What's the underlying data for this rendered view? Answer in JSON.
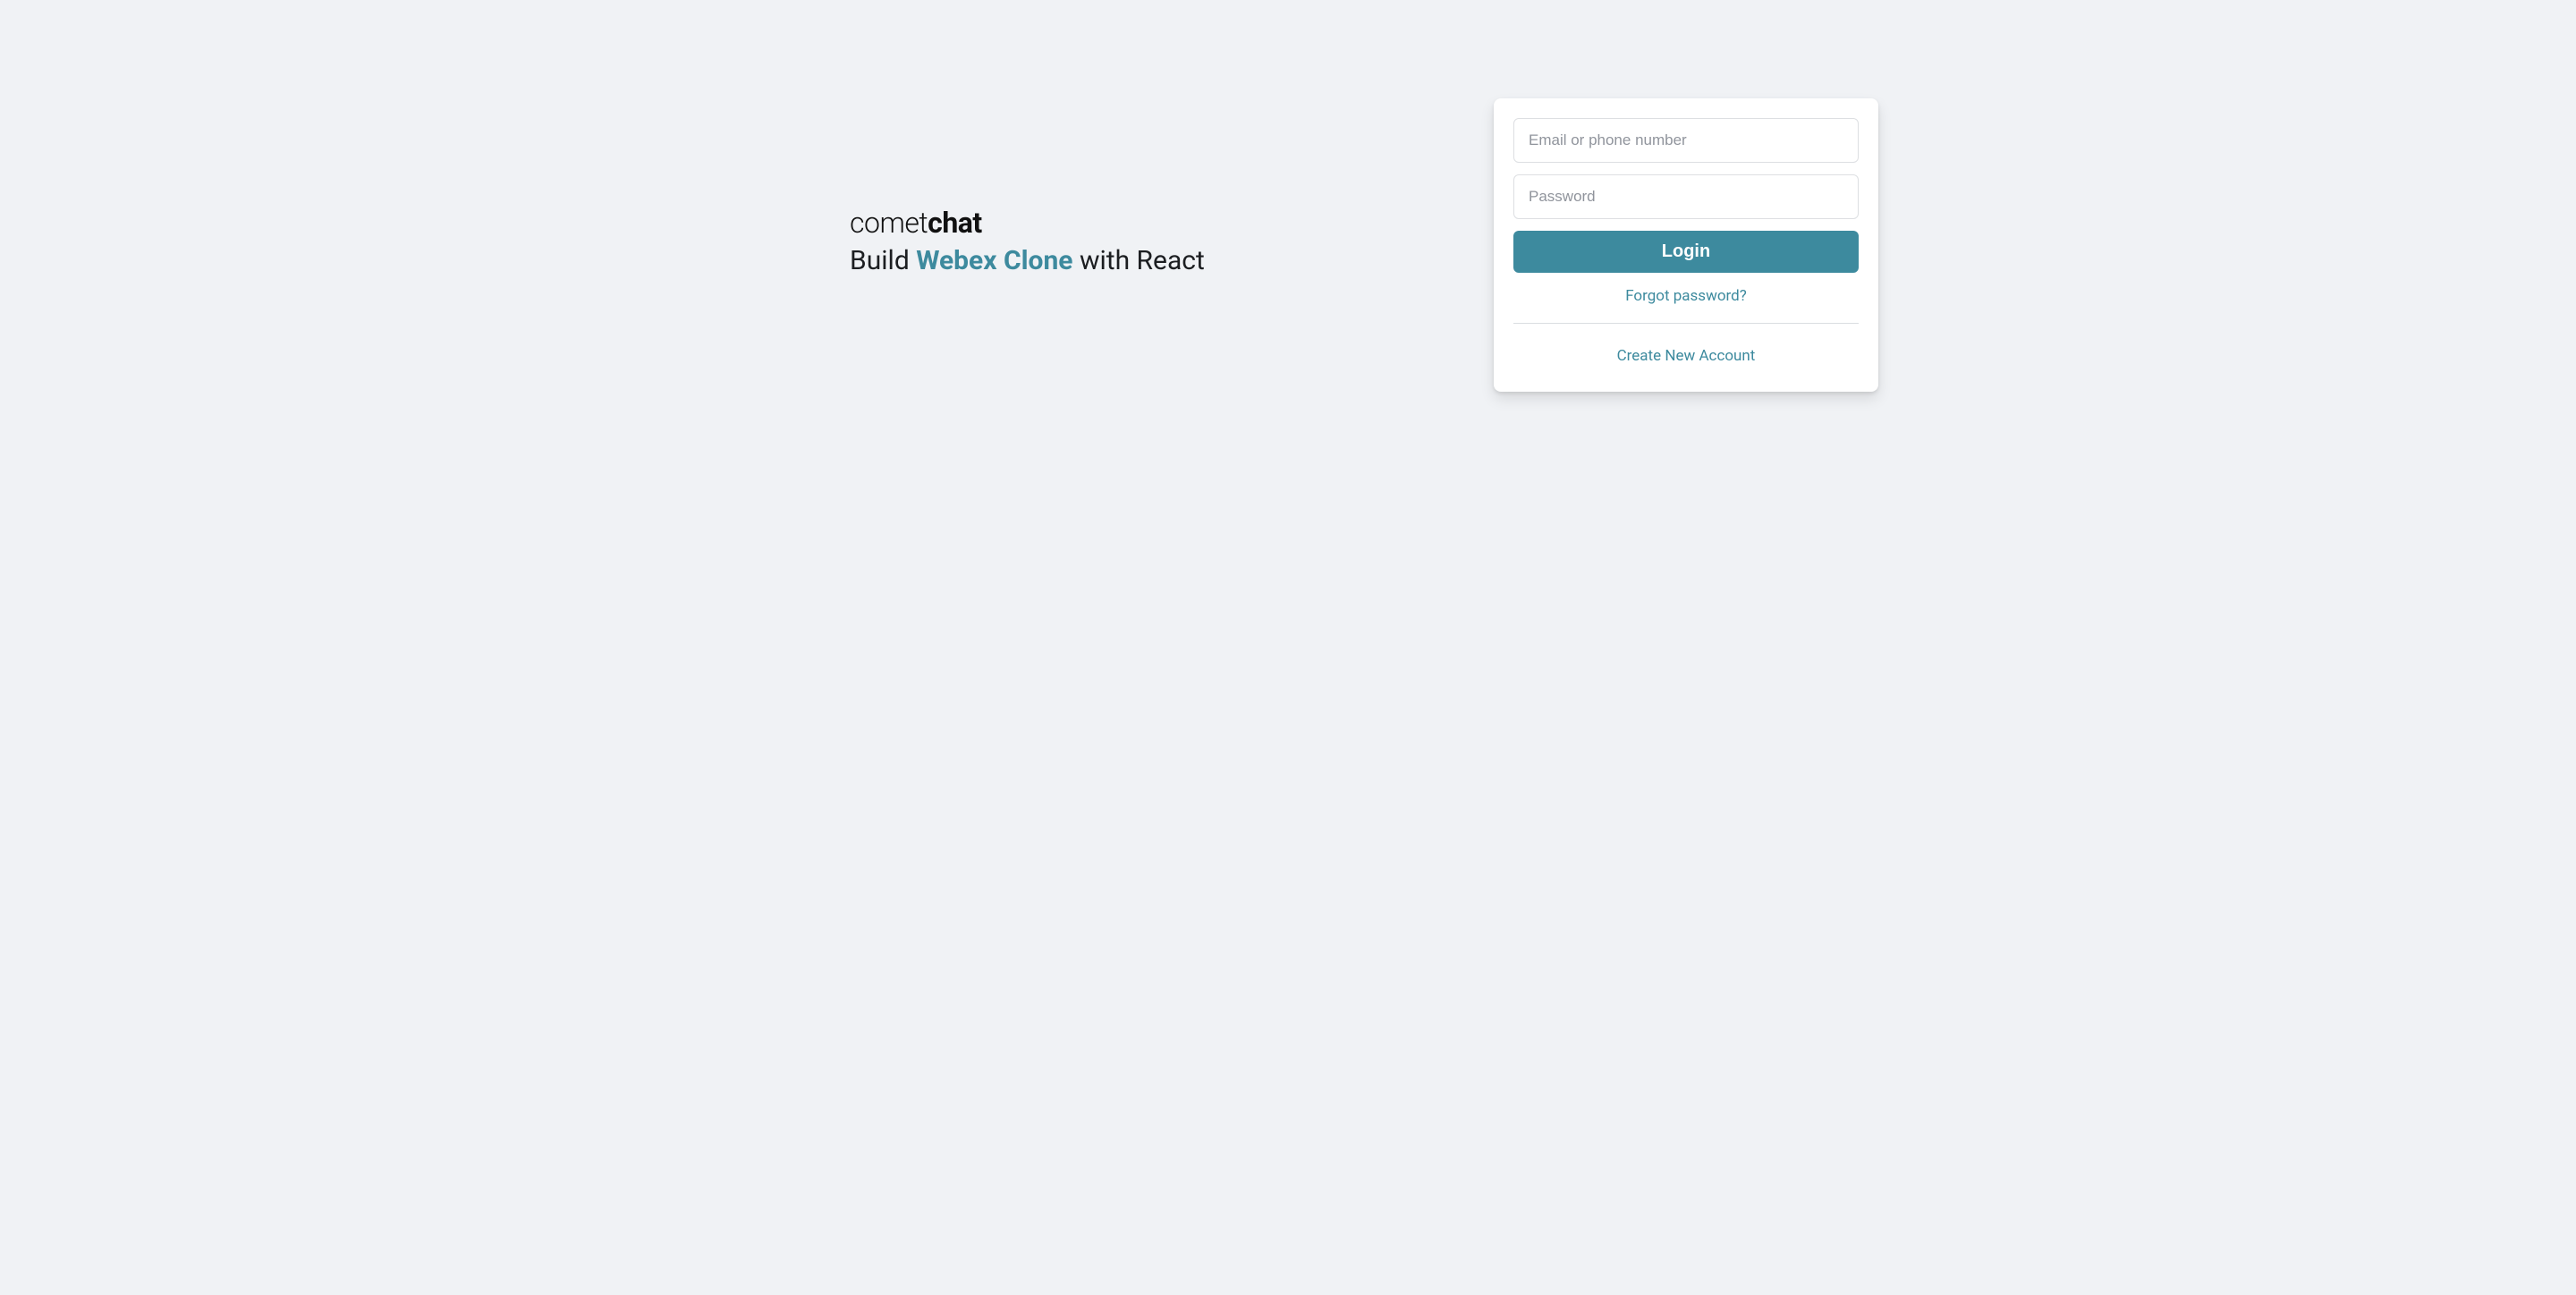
{
  "brand": {
    "logo_light": "comet",
    "logo_bold": "chat"
  },
  "tagline": {
    "prefix": "Build ",
    "highlight": "Webex Clone",
    "suffix": " with React"
  },
  "form": {
    "email_placeholder": "Email or phone number",
    "password_placeholder": "Password",
    "login_button": "Login",
    "forgot_link": "Forgot password?",
    "create_link": "Create New Account"
  },
  "colors": {
    "accent": "#3d8a9e",
    "background": "#f0f2f5",
    "card": "#ffffff"
  }
}
